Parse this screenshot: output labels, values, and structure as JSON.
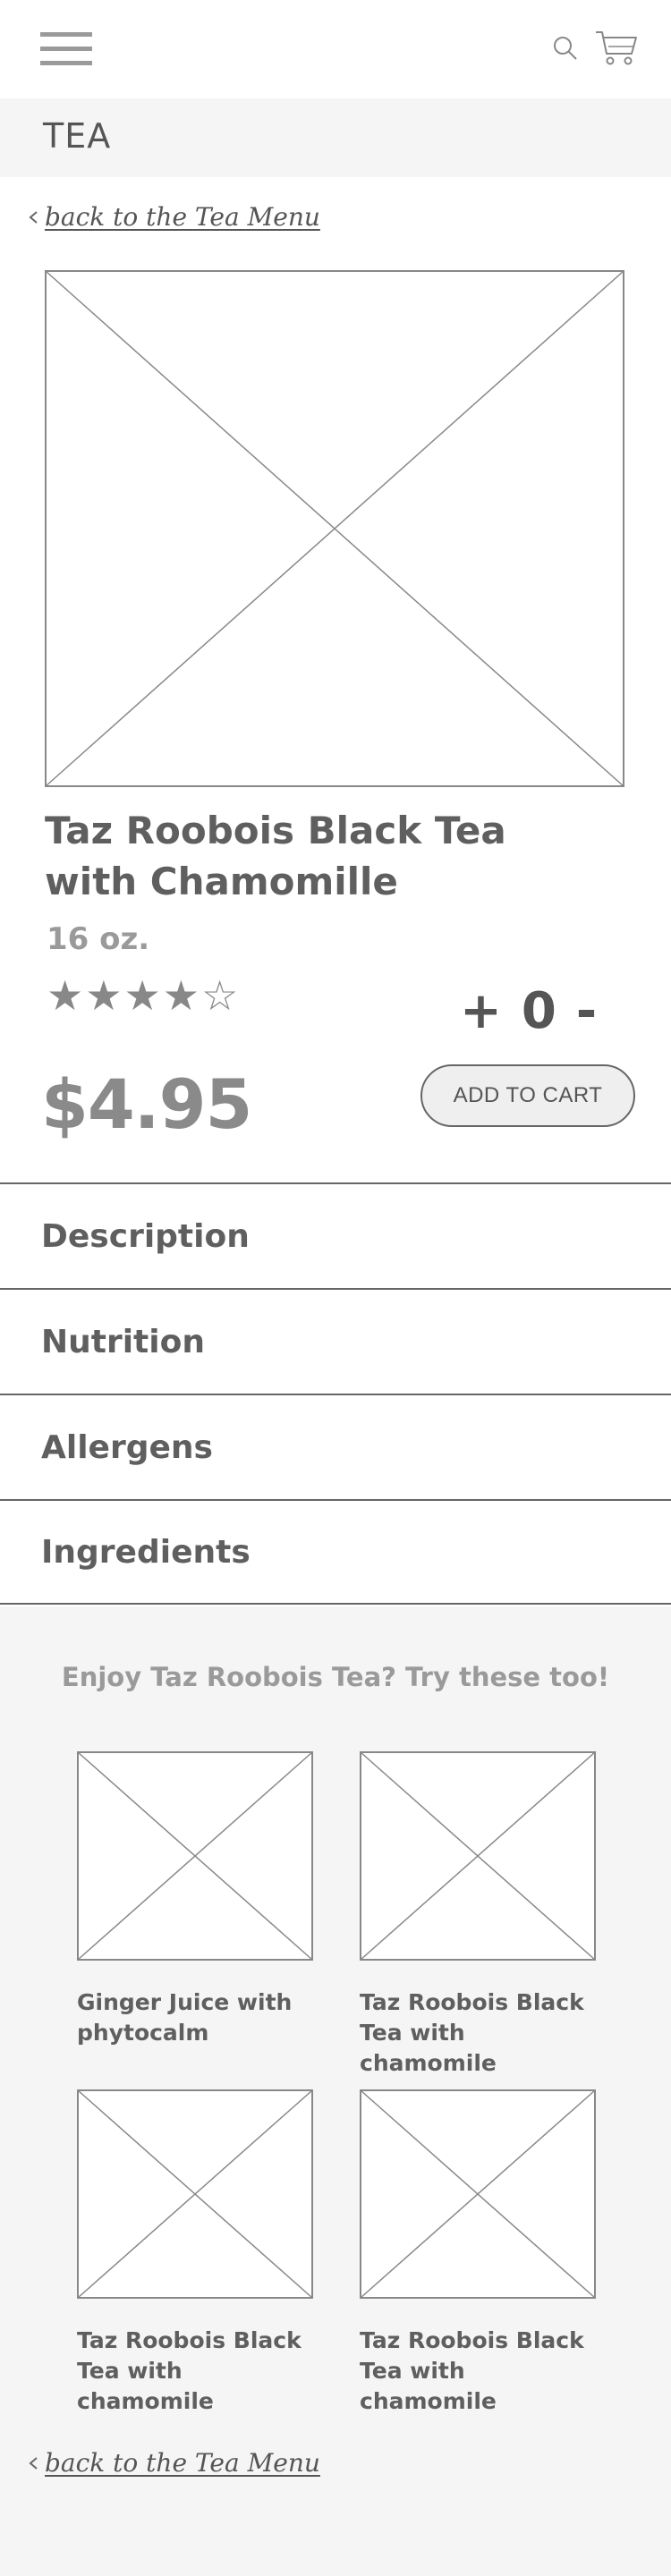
{
  "header": {
    "menu_icon": "hamburger-menu-icon",
    "search_icon": "search-icon",
    "cart_icon": "shopping-cart-icon"
  },
  "category": {
    "title": "TEA"
  },
  "back_link": {
    "label": "back to the Tea Menu"
  },
  "product": {
    "image": "image-placeholder",
    "title_line1": "Taz Roobois Black Tea",
    "title_line2": "with Chamomille",
    "size": "16 oz.",
    "rating": 4,
    "rating_max": 5,
    "price": "$4.95",
    "quantity": "0",
    "plus_label": "+",
    "minus_label": "-",
    "add_to_cart_label": "ADD TO CART"
  },
  "accordion": [
    {
      "label": "Description"
    },
    {
      "label": "Nutrition"
    },
    {
      "label": "Allergens"
    },
    {
      "label": "Ingredients"
    }
  ],
  "related": {
    "heading": "Enjoy Taz Roobois Tea? Try these too!",
    "items": [
      {
        "line1": "Ginger Juice with",
        "line2": "phytocalm"
      },
      {
        "line1": "Taz Roobois Black",
        "line2": "Tea with chamomile"
      },
      {
        "line1": "Taz Roobois Black",
        "line2": "Tea with chamomile"
      },
      {
        "line1": "Taz Roobois Black",
        "line2": "Tea with chamomile"
      }
    ]
  },
  "colors": {
    "text": "#5f5f5f",
    "muted": "#9a9a9a",
    "band": "#f5f5f5",
    "line": "#666666"
  }
}
